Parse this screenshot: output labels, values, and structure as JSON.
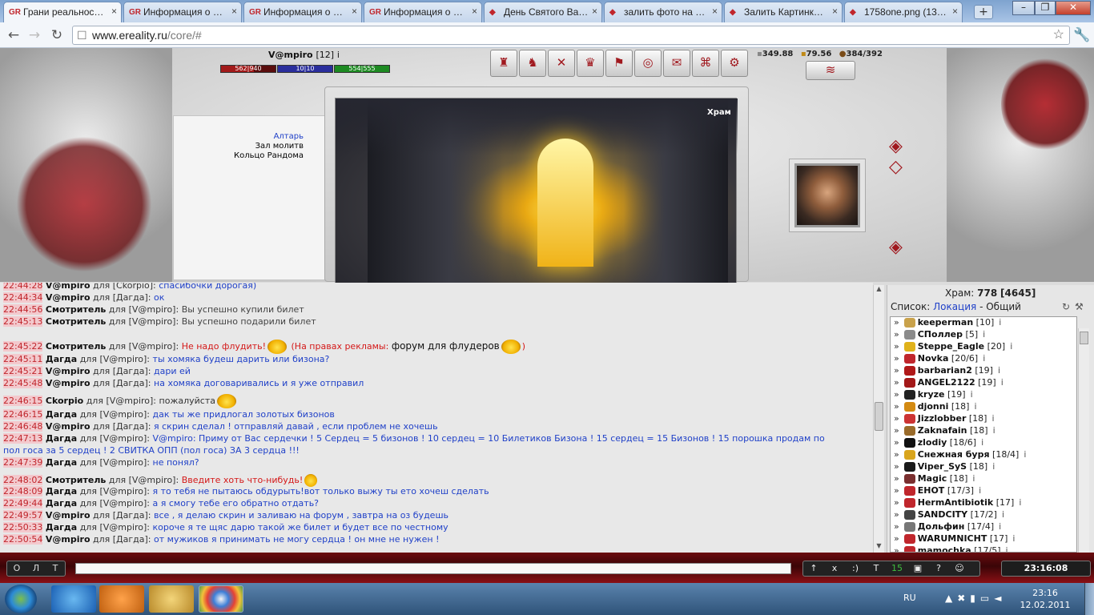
{
  "browser": {
    "tabs": [
      {
        "title": "Грани реальнос…",
        "icon": "ereality-icon",
        "active": true
      },
      {
        "title": "Информация о …",
        "icon": "ereality-icon",
        "active": false
      },
      {
        "title": "Информация о …",
        "icon": "ereality-icon",
        "active": false
      },
      {
        "title": "Информация о …",
        "icon": "ereality-icon",
        "active": false
      },
      {
        "title": "День Святого Ва…",
        "icon": "feather-icon",
        "active": false
      },
      {
        "title": "залить фото на …",
        "icon": "google-icon",
        "active": false
      },
      {
        "title": "Залить Картинк…",
        "icon": "image-host-icon",
        "active": false
      },
      {
        "title": "1758one.png (13…",
        "icon": "image-icon",
        "active": false
      }
    ],
    "url_host": "www.ereality.ru",
    "url_path": "/core/#"
  },
  "player": {
    "name": "V@mpiro",
    "level": "[12]",
    "hp": "562|940",
    "mana": "10|10",
    "energy": "554|555"
  },
  "resources": {
    "money": "349.88",
    "gold": "79.56",
    "weight": "384/392"
  },
  "location": {
    "name": "Храм",
    "links": [
      "Алтарь",
      "Зал молитв",
      "Кольцо Рандома"
    ]
  },
  "chat": [
    {
      "time": "22:44:28",
      "from": "V@mpiro",
      "to": "для [Ckorpio]:",
      "text": "спасибочки дорогая)",
      "kind": "msg"
    },
    {
      "time": "22:44:34",
      "from": "V@mpiro",
      "to": "для [Дагда]:",
      "text": "ок",
      "kind": "msg"
    },
    {
      "time": "22:44:56",
      "from": "Смотритель",
      "to": "для [V@mpiro]:",
      "text": "Вы успешно купили билет",
      "kind": "sys"
    },
    {
      "time": "22:45:13",
      "from": "Смотритель",
      "to": "для [V@mpiro]:",
      "text": "Вы успешно подарили билет",
      "kind": "sys"
    },
    {
      "time": "22:45:22",
      "from": "Смотритель",
      "to": "для [V@mpiro]:",
      "text": "Не надо флудить!",
      "kind": "red",
      "extra_red": "(На правах рекламы:",
      "extra_black": "форум для флудеров",
      "extra_close": ")"
    },
    {
      "time": "22:45:11",
      "from": "Дагда",
      "to": "для [V@mpiro]:",
      "text": "ты хомяка будеш дарить или бизона?",
      "kind": "dark"
    },
    {
      "time": "22:45:21",
      "from": "V@mpiro",
      "to": "для [Дагда]:",
      "text": "дари ей",
      "kind": "msg"
    },
    {
      "time": "22:45:48",
      "from": "V@mpiro",
      "to": "для [Дагда]:",
      "text": "на хомяка договаривались и я уже отправил",
      "kind": "msg"
    },
    {
      "time": "22:46:15",
      "from": "Ckorpio",
      "to": "для [V@mpiro]:",
      "text": "пожалуйста",
      "kind": "plain"
    },
    {
      "time": "22:46:15",
      "from": "Дагда",
      "to": "для [V@mpiro]:",
      "text": "дак ты же придлогал золотых бизонов",
      "kind": "dark"
    },
    {
      "time": "22:46:48",
      "from": "V@mpiro",
      "to": "для [Дагда]:",
      "text": "я скрин сделал ! отправляй давай , если проблем не хочешь",
      "kind": "msg"
    },
    {
      "time": "22:47:13",
      "from": "Дагда",
      "to": "для [V@mpiro]:",
      "text": "V@mpiro: Приму от Вас сердечки ! 5 Сердец = 5 бизонов ! 10 сердец = 10 Билетиков Бизона ! 15 сердец = 15 Бизонов ! 15 порошка продам по",
      "text2": "пол госа за 5 сердец ! 2 СВИТКА ОПП (пол госа) ЗА 3 сердца !!!",
      "kind": "dark"
    },
    {
      "time": "22:47:39",
      "from": "Дагда",
      "to": "для [V@mpiro]:",
      "text": "не понял?",
      "kind": "dark"
    },
    {
      "time": "22:48:02",
      "from": "Смотритель",
      "to": "для [V@mpiro]:",
      "text": "Введите хоть что-нибудь!",
      "kind": "red"
    },
    {
      "time": "22:48:09",
      "from": "Дагда",
      "to": "для [V@mpiro]:",
      "text": "я то тебя не пытаюсь обдурыть!вот только выжу ты ето хочеш сделать",
      "kind": "dark"
    },
    {
      "time": "22:49:44",
      "from": "Дагда",
      "to": "для [V@mpiro]:",
      "text": "а я смогу тебе его обратно отдать?",
      "kind": "dark"
    },
    {
      "time": "22:49:57",
      "from": "V@mpiro",
      "to": "для [Дагда]:",
      "text": "все , я делаю скрин и заливаю на форум , завтра на оз будешь",
      "kind": "msg"
    },
    {
      "time": "22:50:33",
      "from": "Дагда",
      "to": "для [V@mpiro]:",
      "text": "короче я те щяс дарю такой же билет и будет все по честному",
      "kind": "dark"
    },
    {
      "time": "22:50:54",
      "from": "V@mpiro",
      "to": "для [Дагда]:",
      "text": "от мужиков я принимать не могу сердца ! он мне не нужен !",
      "kind": "msg"
    }
  ],
  "userpanel": {
    "title_label": "Храм:",
    "online": "778",
    "total": "[4645]",
    "list_label": "Список:",
    "tab_location": "Локация",
    "tab_general": "- Общий"
  },
  "users": [
    {
      "name": "keeperman",
      "level": "[10]",
      "icon": "clan-icon"
    },
    {
      "name": "СПоллер",
      "level": "[5]",
      "icon": "clan-icon"
    },
    {
      "name": "Steppe_Eagle",
      "level": "[20]",
      "icon": "clan-icon"
    },
    {
      "name": "Novka",
      "level": "[20/6]",
      "icon": "clan-icon"
    },
    {
      "name": "barbarian2",
      "level": "[19]",
      "icon": "clan-icon"
    },
    {
      "name": "ANGEL2122",
      "level": "[19]",
      "icon": "clan-icon"
    },
    {
      "name": "kryze",
      "level": "[19]",
      "icon": "clan-icon"
    },
    {
      "name": "djonni",
      "level": "[18]",
      "icon": "clan-icon"
    },
    {
      "name": "Jizzlobber",
      "level": "[18]",
      "icon": "clan-icon"
    },
    {
      "name": "Zaknafain",
      "level": "[18]",
      "icon": "clan-icon"
    },
    {
      "name": "zlodiy",
      "level": "[18/6]",
      "icon": "clan-icon"
    },
    {
      "name": "Снежная буря",
      "level": "[18/4]",
      "icon": "clan-icon"
    },
    {
      "name": "Viper_SyS",
      "level": "[18]",
      "icon": "clan-icon"
    },
    {
      "name": "Magic",
      "level": "[18]",
      "icon": "clan-icon"
    },
    {
      "name": "EHOT",
      "level": "[17/3]",
      "icon": "clan-icon"
    },
    {
      "name": "HermAntibiotik",
      "level": "[17]",
      "icon": "clan-icon"
    },
    {
      "name": "SANDCITY",
      "level": "[17/2]",
      "icon": "clan-icon"
    },
    {
      "name": "Дольфин",
      "level": "[17/4]",
      "icon": "clan-icon"
    },
    {
      "name": "WARUMNICHT",
      "level": "[17]",
      "icon": "clan-icon"
    },
    {
      "name": "mamochka",
      "level": "[17/5]",
      "icon": "clan-icon"
    }
  ],
  "bottombar": {
    "left_buttons": [
      "О",
      "Л",
      "Т"
    ],
    "right_buttons": [
      "↑",
      "x",
      ":)",
      "T",
      "15",
      "▣",
      "?",
      "☺"
    ],
    "clock": "23:16:08"
  },
  "taskbar": {
    "lang": "RU",
    "time": "23:16",
    "date": "12.02.2011"
  }
}
